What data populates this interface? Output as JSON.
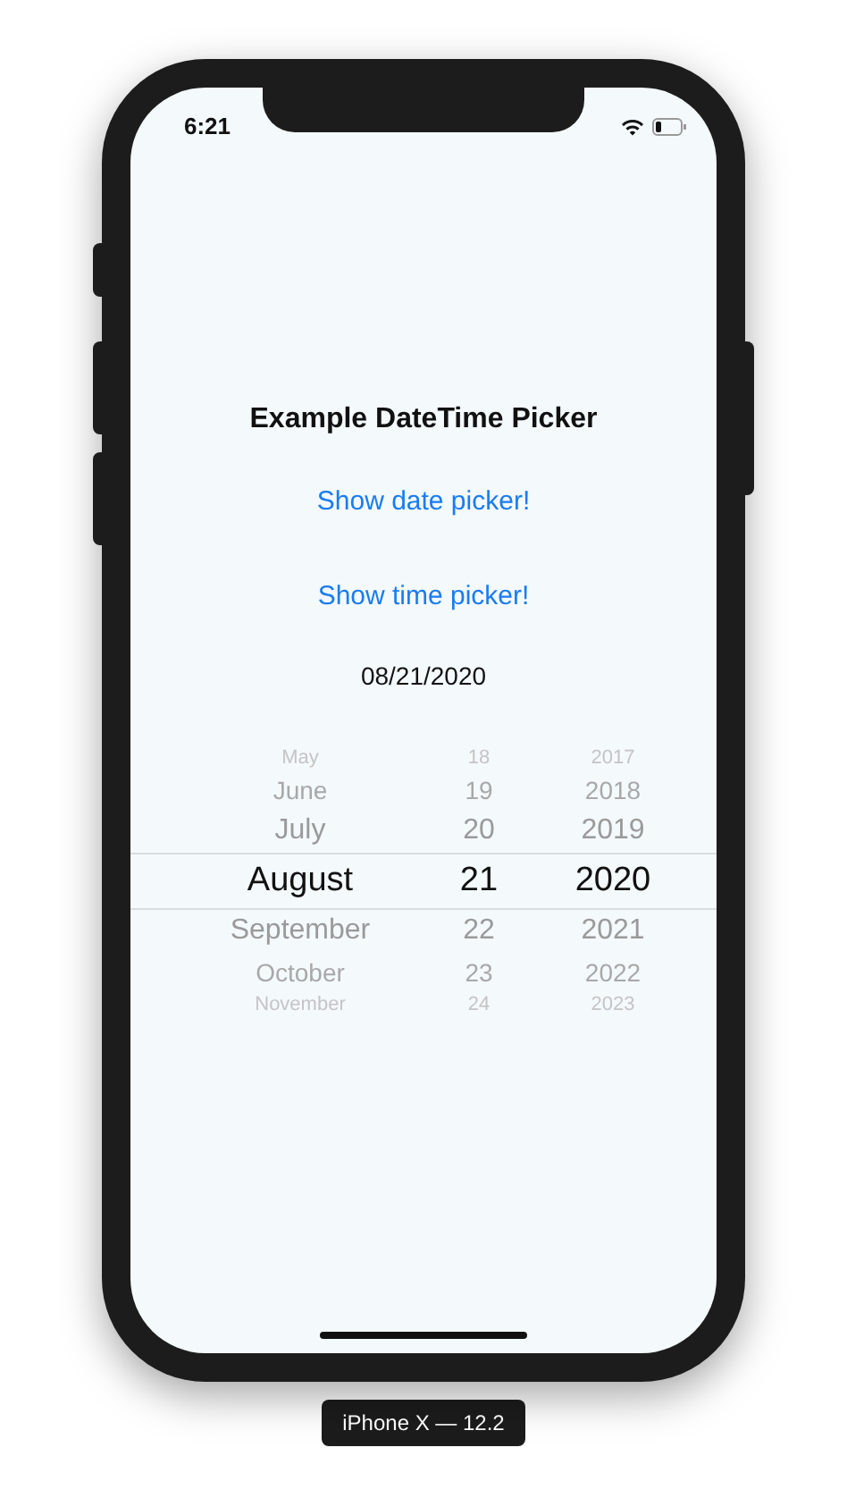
{
  "status_bar": {
    "time": "6:21"
  },
  "title": "Example DateTime Picker",
  "links": [
    "Show date picker!",
    "Show time picker!"
  ],
  "date_value": "08/21/2020",
  "picker": {
    "rows": [
      {
        "month": "May",
        "day": "18",
        "year": "2017",
        "selected": false
      },
      {
        "month": "June",
        "day": "19",
        "year": "2018",
        "selected": false
      },
      {
        "month": "July",
        "day": "20",
        "year": "2019",
        "selected": false
      },
      {
        "month": "August",
        "day": "21",
        "year": "2020",
        "selected": true
      },
      {
        "month": "September",
        "day": "22",
        "year": "2021",
        "selected": false
      },
      {
        "month": "October",
        "day": "23",
        "year": "2022",
        "selected": false
      },
      {
        "month": "November",
        "day": "24",
        "year": "2023",
        "selected": false
      }
    ]
  },
  "device_label": "iPhone X — 12.2"
}
